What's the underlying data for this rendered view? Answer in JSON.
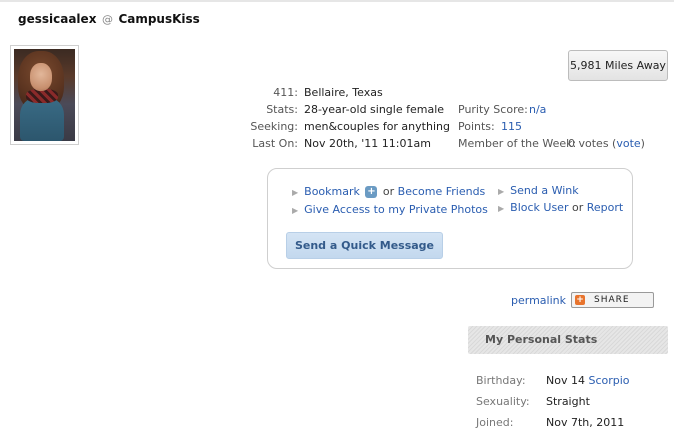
{
  "header": {
    "username": "gessicaalex",
    "at": "@",
    "site": "CampusKiss"
  },
  "distance": {
    "label": "5,981 Miles Away"
  },
  "profile": {
    "location": {
      "label": "411:",
      "value": "Bellaire, Texas"
    },
    "stats": {
      "label": "Stats:",
      "value": "28-year-old single female"
    },
    "seeking": {
      "label": "Seeking:",
      "value": "men&couples for anything"
    },
    "last_on": {
      "label": "Last On:",
      "value": "Nov 20th, '11 11:01am"
    },
    "purity": {
      "label": "Purity Score:",
      "value": "n/a"
    },
    "points": {
      "label": "Points:",
      "value": "115"
    },
    "motw": {
      "label": "Member of the Week:",
      "votes": "0 votes",
      "open_paren": "(",
      "vote_link": "vote",
      "close_paren": ")"
    }
  },
  "actions": {
    "bookmark": "Bookmark",
    "or1": "or",
    "become_friends": "Become Friends",
    "give_access": "Give Access to my Private Photos",
    "send_wink": "Send a Wink",
    "block_user": "Block User",
    "or2": "or",
    "report": "Report",
    "quick_message": "Send a Quick Message"
  },
  "permalink": "permalink",
  "share": "SHARE",
  "personal_stats": {
    "title": "My Personal Stats",
    "rows": [
      {
        "label": "Birthday:",
        "value": "Nov 14",
        "link": "Scorpio"
      },
      {
        "label": "Sexuality:",
        "value": "Straight"
      },
      {
        "label": "Joined:",
        "value": "Nov 7th, 2011"
      }
    ]
  },
  "icons": {
    "plus": "+",
    "share": "+",
    "bullet": "▶"
  },
  "colors": {
    "link": "#2a5db0",
    "button_bg": "#c3d8ee",
    "share_icon": "#e8742d"
  }
}
